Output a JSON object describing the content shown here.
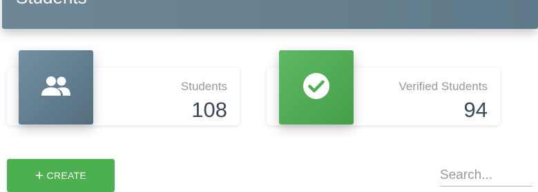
{
  "header": {
    "title": "Students"
  },
  "stats": [
    {
      "label": "Students",
      "value": "108",
      "icon": "people-icon",
      "color": "#607d8b"
    },
    {
      "label": "Verified Students",
      "value": "94",
      "icon": "check-circle-icon",
      "color": "#4caf50"
    }
  ],
  "actions": {
    "create_label": "CREATE"
  },
  "search": {
    "placeholder": "Search..."
  }
}
